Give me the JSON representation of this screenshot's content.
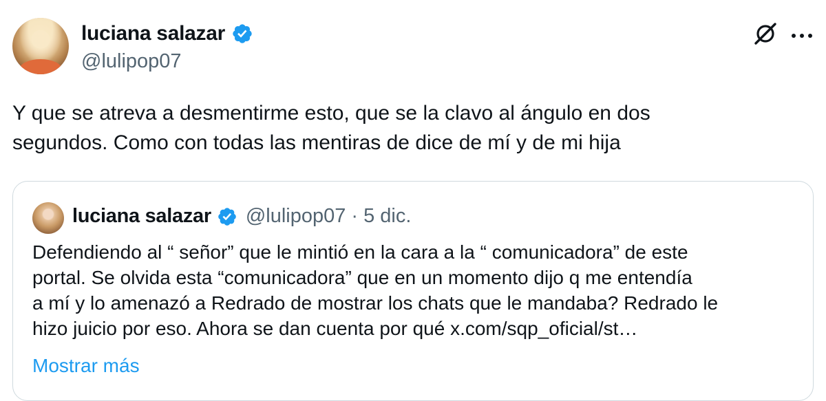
{
  "author": {
    "name": "luciana salazar",
    "handle": "@lulipop07"
  },
  "header_icons": [
    "grok-icon",
    "more-options-icon"
  ],
  "tweet": {
    "text": "Y que se atreva a desmentirme esto, que se la clavo al ángulo en dos\nsegundos. Como con todas las mentiras de dice de mí y de mi hija"
  },
  "quoted_tweet": {
    "name": "luciana salazar",
    "handle": "@lulipop07",
    "separator": "·",
    "date": "5 dic.",
    "text": "Defendiendo al “ señor”  que le mintió en la cara a la “ comunicadora” de este\nportal. Se olvida esta “comunicadora” que en un momento dijo q me entendía\na mí y lo amenazó a Redrado de mostrar los chats que le mandaba? Redrado le\nhizo juicio por eso.  Ahora se dan cuenta por qué x.com/sqp_oficial/st…",
    "show_more_label": "Mostrar más"
  },
  "colors": {
    "verified_badge": "#1d9bf0",
    "link": "#1d9bf0",
    "secondary_text": "#536471",
    "border": "#cfd9de"
  }
}
